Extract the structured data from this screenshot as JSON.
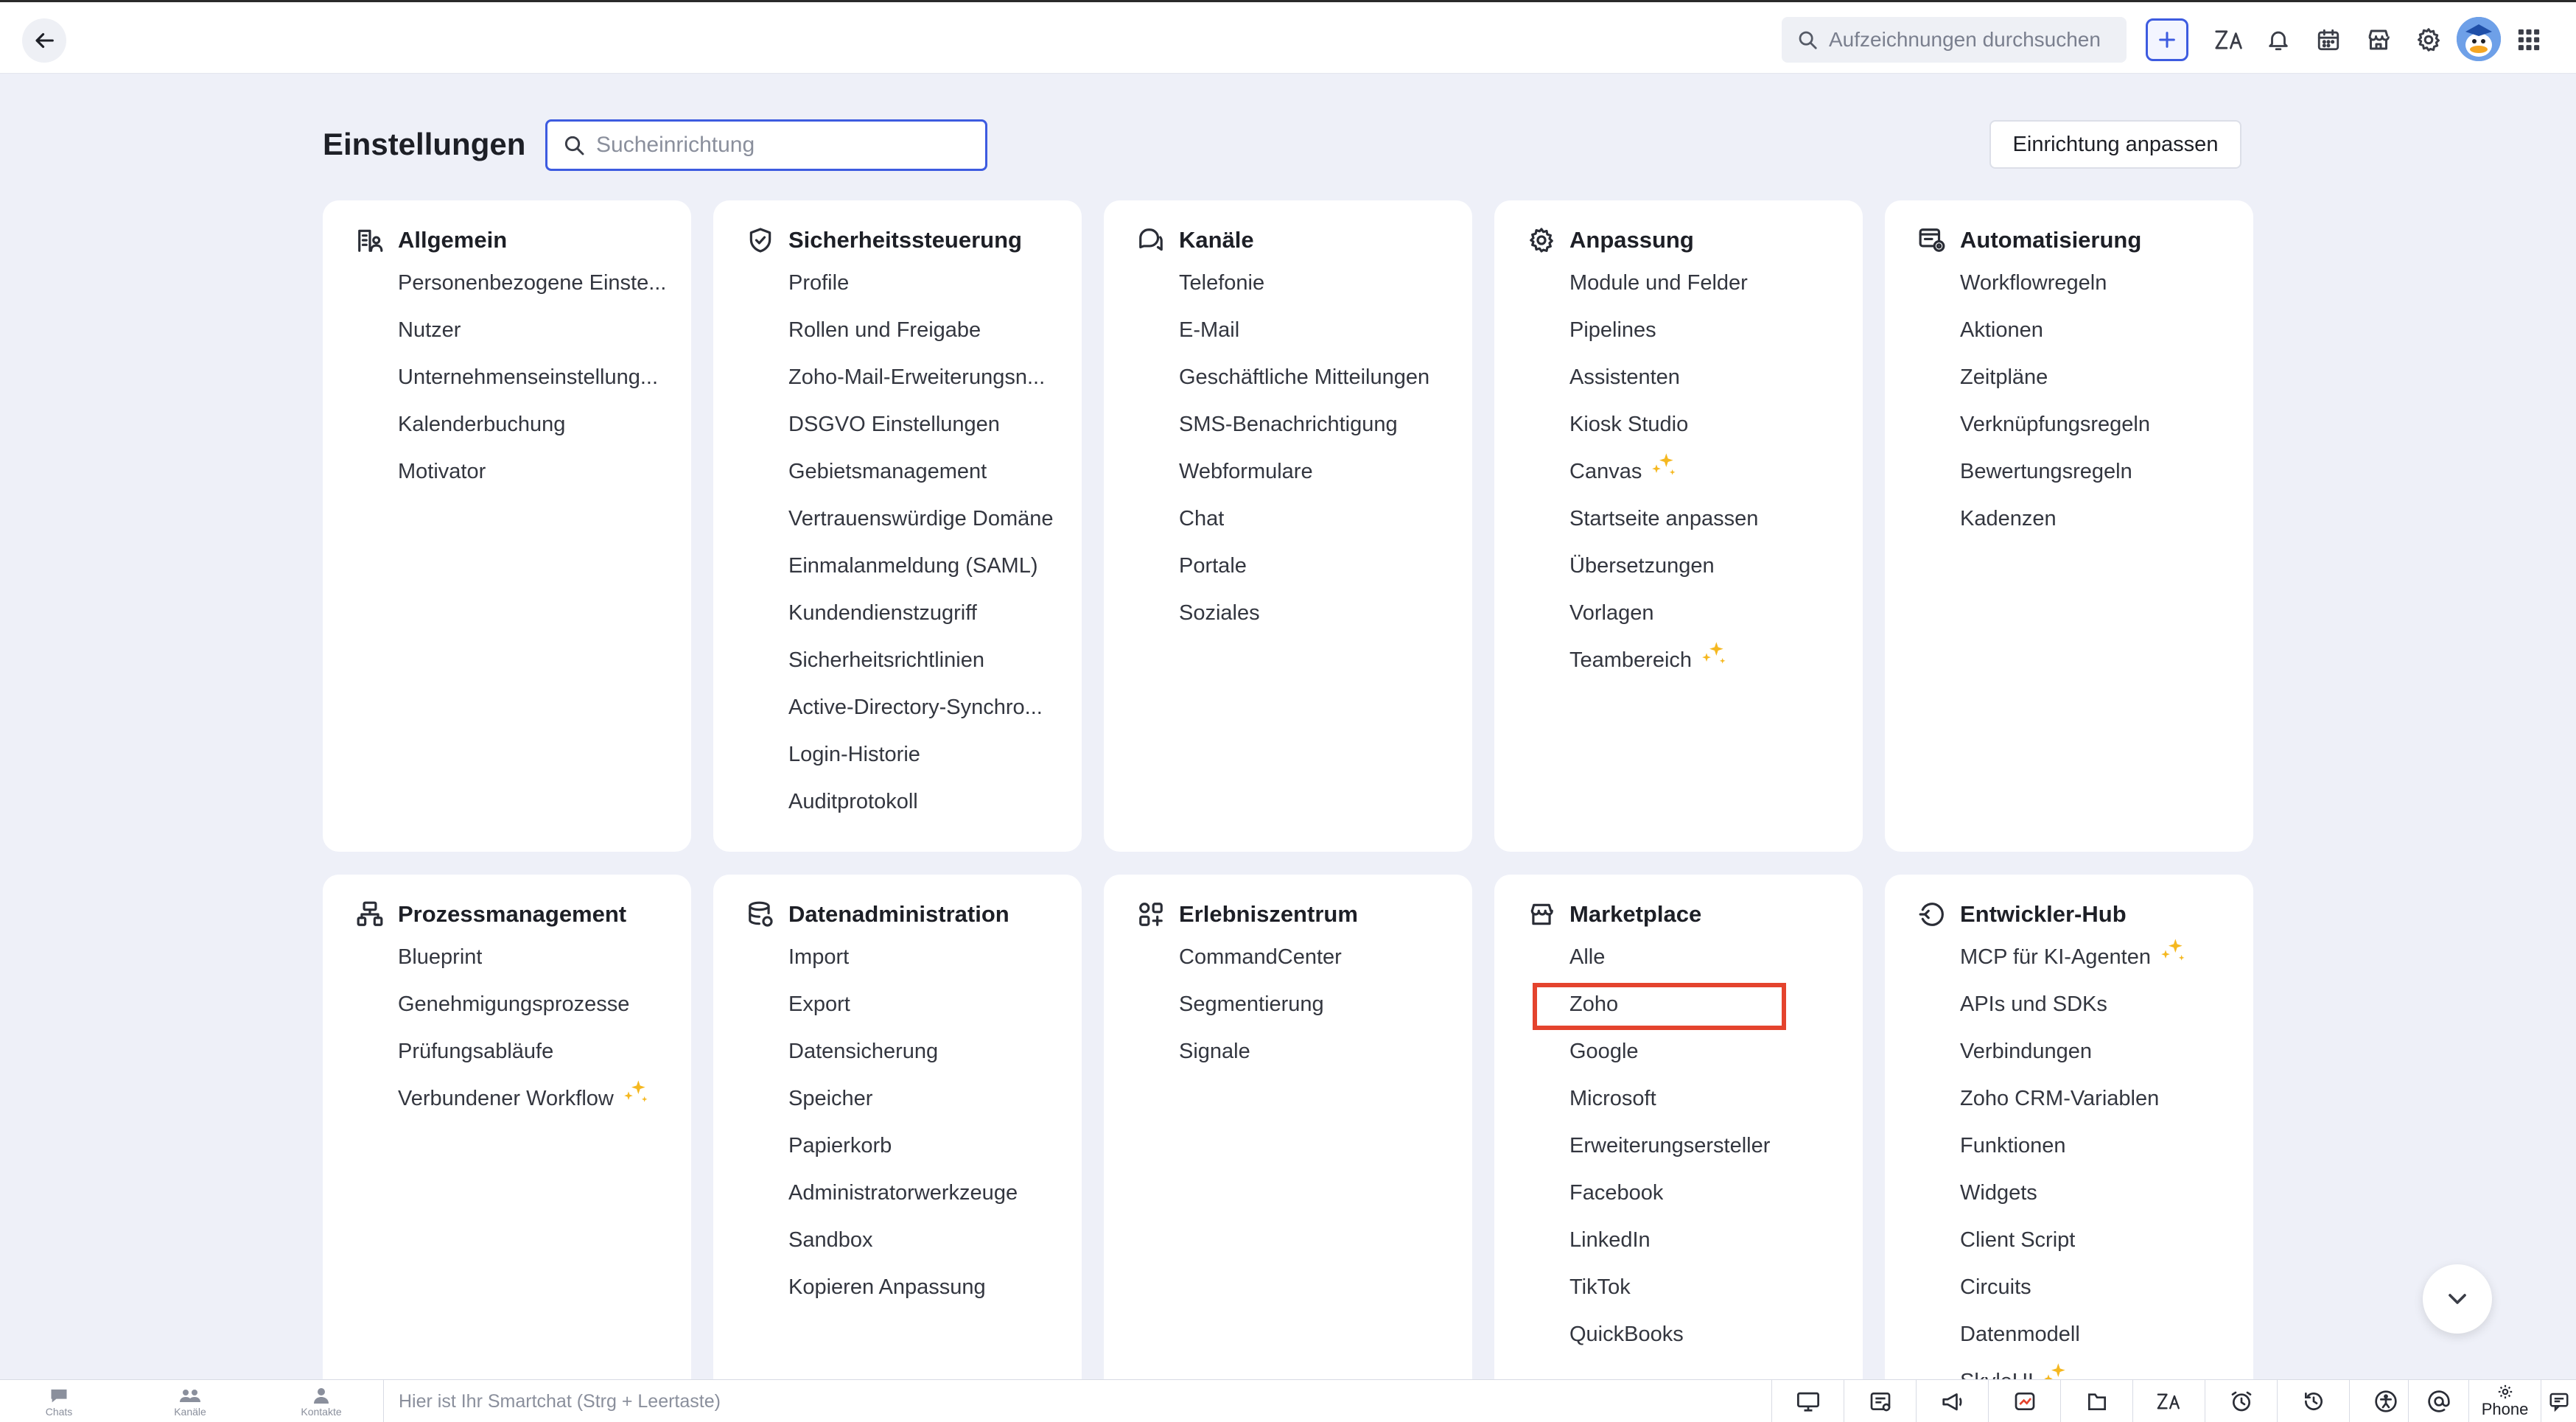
{
  "topbar": {
    "search_placeholder": "Aufzeichnungen durchsuchen",
    "icons": [
      "back-arrow-icon",
      "search-icon",
      "plus-icon",
      "translate-icon",
      "bell-icon",
      "calendar-icon",
      "marketplace-icon",
      "gear-icon",
      "avatar",
      "apps-grid-icon"
    ]
  },
  "header": {
    "title": "Einstellungen",
    "search_placeholder": "Sucheinrichtung",
    "customize_label": "Einrichtung anpassen"
  },
  "colors": {
    "accent": "#3d5be0",
    "highlight": "#e4432d",
    "sparkle": "#f5b820",
    "background": "#eef0f8"
  },
  "cards": [
    {
      "id": "allgemein",
      "title": "Allgemein",
      "icon": "building-user-icon",
      "items": [
        {
          "label": "Personenbezogene Einstellungen",
          "display": "Personenbezogene Einste..."
        },
        {
          "label": "Nutzer"
        },
        {
          "label": "Unternehmenseinstellungen",
          "display": "Unternehmenseinstellung..."
        },
        {
          "label": "Kalenderbuchung"
        },
        {
          "label": "Motivator"
        }
      ]
    },
    {
      "id": "sicherheit",
      "title": "Sicherheitssteuerung",
      "icon": "shield-check-icon",
      "items": [
        {
          "label": "Profile"
        },
        {
          "label": "Rollen und Freigabe"
        },
        {
          "label": "Zoho-Mail-Erweiterungseinstellungen",
          "display": "Zoho-Mail-Erweiterungsn..."
        },
        {
          "label": "DSGVO Einstellungen"
        },
        {
          "label": "Gebietsmanagement"
        },
        {
          "label": "Vertrauenswürdige Domäne"
        },
        {
          "label": "Einmalanmeldung (SAML)"
        },
        {
          "label": "Kundendienstzugriff"
        },
        {
          "label": "Sicherheitsrichtlinien"
        },
        {
          "label": "Active-Directory-Synchronisierung",
          "display": "Active-Directory-Synchro..."
        },
        {
          "label": "Login-Historie"
        },
        {
          "label": "Auditprotokoll"
        }
      ]
    },
    {
      "id": "kanaele",
      "title": "Kanäle",
      "icon": "chat-bubbles-icon",
      "items": [
        {
          "label": "Telefonie"
        },
        {
          "label": "E-Mail"
        },
        {
          "label": "Geschäftliche Mitteilungen"
        },
        {
          "label": "SMS-Benachrichtigung"
        },
        {
          "label": "Webformulare"
        },
        {
          "label": "Chat"
        },
        {
          "label": "Portale"
        },
        {
          "label": "Soziales"
        }
      ]
    },
    {
      "id": "anpassung",
      "title": "Anpassung",
      "icon": "gear-icon",
      "items": [
        {
          "label": "Module und Felder"
        },
        {
          "label": "Pipelines"
        },
        {
          "label": "Assistenten"
        },
        {
          "label": "Kiosk Studio"
        },
        {
          "label": "Canvas",
          "sparkle": true
        },
        {
          "label": "Startseite anpassen"
        },
        {
          "label": "Übersetzungen"
        },
        {
          "label": "Vorlagen"
        },
        {
          "label": "Teambereich",
          "sparkle": true
        }
      ]
    },
    {
      "id": "automatisierung",
      "title": "Automatisierung",
      "icon": "automation-icon",
      "items": [
        {
          "label": "Workflowregeln"
        },
        {
          "label": "Aktionen"
        },
        {
          "label": "Zeitpläne"
        },
        {
          "label": "Verknüpfungsregeln"
        },
        {
          "label": "Bewertungsregeln"
        },
        {
          "label": "Kadenzen"
        }
      ]
    },
    {
      "id": "prozess",
      "title": "Prozessmanagement",
      "icon": "process-flow-icon",
      "items": [
        {
          "label": "Blueprint"
        },
        {
          "label": "Genehmigungsprozesse"
        },
        {
          "label": "Prüfungsabläufe"
        },
        {
          "label": "Verbundener Workflow",
          "sparkle": true
        }
      ]
    },
    {
      "id": "daten",
      "title": "Datenadministration",
      "icon": "database-icon",
      "items": [
        {
          "label": "Import"
        },
        {
          "label": "Export"
        },
        {
          "label": "Datensicherung"
        },
        {
          "label": "Speicher"
        },
        {
          "label": "Papierkorb"
        },
        {
          "label": "Administratorwerkzeuge"
        },
        {
          "label": "Sandbox"
        },
        {
          "label": "Kopieren Anpassung"
        }
      ]
    },
    {
      "id": "erlebnis",
      "title": "Erlebniszentrum",
      "icon": "experience-grid-icon",
      "items": [
        {
          "label": "CommandCenter"
        },
        {
          "label": "Segmentierung"
        },
        {
          "label": "Signale"
        }
      ]
    },
    {
      "id": "marketplace",
      "title": "Marketplace",
      "icon": "store-icon",
      "items": [
        {
          "label": "Alle"
        },
        {
          "label": "Zoho",
          "highlighted": true
        },
        {
          "label": "Google"
        },
        {
          "label": "Microsoft"
        },
        {
          "label": "Erweiterungsersteller"
        },
        {
          "label": "Facebook"
        },
        {
          "label": "LinkedIn"
        },
        {
          "label": "TikTok"
        },
        {
          "label": "QuickBooks"
        }
      ]
    },
    {
      "id": "entwickler",
      "title": "Entwickler-Hub",
      "icon": "developer-hub-icon",
      "items": [
        {
          "label": "MCP für KI-Agenten",
          "sparkle": true
        },
        {
          "label": "APIs und SDKs"
        },
        {
          "label": "Verbindungen"
        },
        {
          "label": "Zoho CRM-Variablen"
        },
        {
          "label": "Funktionen"
        },
        {
          "label": "Widgets"
        },
        {
          "label": "Client Script"
        },
        {
          "label": "Circuits"
        },
        {
          "label": "Datenmodell"
        },
        {
          "label": "SkyleUI",
          "display": "SkyleUI",
          "sparkle": true
        }
      ]
    }
  ],
  "bottombar": {
    "tabs": [
      {
        "label": "Chats",
        "icon": "chat-icon"
      },
      {
        "label": "Kanäle",
        "icon": "users-icon"
      },
      {
        "label": "Kontakte",
        "icon": "contact-icon"
      }
    ],
    "smartchat_placeholder": "Hier ist Ihr Smartchat (Strg + Leertaste)",
    "phone_label": "Phone"
  }
}
